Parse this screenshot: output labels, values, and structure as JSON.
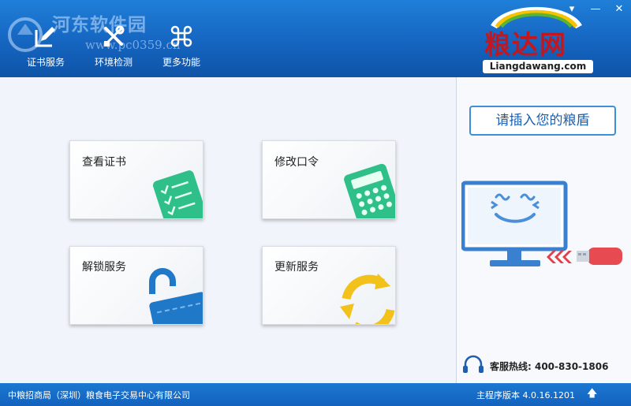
{
  "watermark": {
    "title": "河东软件园",
    "url": "www.pc0359.cn"
  },
  "toolbar": {
    "items": [
      {
        "label": "证书服务",
        "icon": "certificate-edit-icon"
      },
      {
        "label": "环境检测",
        "icon": "tools-icon"
      },
      {
        "label": "更多功能",
        "icon": "command-icon"
      }
    ]
  },
  "window_controls": {
    "menu": "▾",
    "minimize": "—",
    "close": "✕"
  },
  "brand": {
    "name": "粮达网",
    "url": "Liangdawang.com",
    "color": "#c4161c"
  },
  "cards": [
    {
      "title": "查看证书",
      "icon": "certificate-list-icon"
    },
    {
      "title": "修改口令",
      "icon": "calculator-icon"
    },
    {
      "title": "解锁服务",
      "icon": "unlock-icon"
    },
    {
      "title": "更新服务",
      "icon": "refresh-icon"
    }
  ],
  "side": {
    "insert_button": "请插入您的粮盾",
    "hotline": "客服热线: 400-830-1806"
  },
  "footer": {
    "company": "中粮招商局（深圳）粮食电子交易中心有限公司",
    "version": "主程序版本 4.0.16.1201",
    "up_icon": "🡅"
  },
  "colors": {
    "header": "#1565c0",
    "accent": "#3f8ed6",
    "green": "#2fc08a",
    "blue_icon": "#1f78c8",
    "yellow_icon": "#f2c21b"
  }
}
